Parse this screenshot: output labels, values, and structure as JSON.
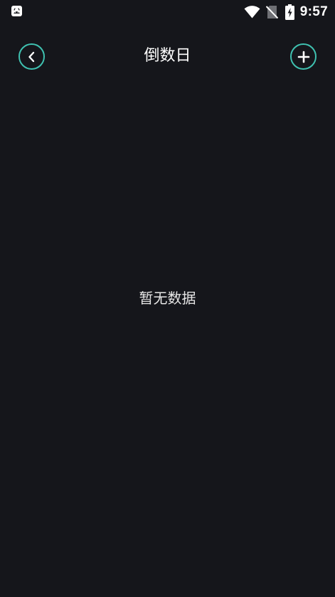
{
  "status_bar": {
    "time": "9:57",
    "app_icon": "android-notification-icon",
    "wifi_icon": "wifi-icon",
    "sim_icon": "no-sim-icon",
    "battery_icon": "battery-charging-icon"
  },
  "header": {
    "title": "倒数日",
    "back_icon": "chevron-left-icon",
    "add_icon": "plus-icon"
  },
  "main": {
    "empty_text": "暂无数据"
  },
  "colors": {
    "background": "#15161b",
    "accent": "#3fc1b0",
    "text": "#ffffff"
  }
}
